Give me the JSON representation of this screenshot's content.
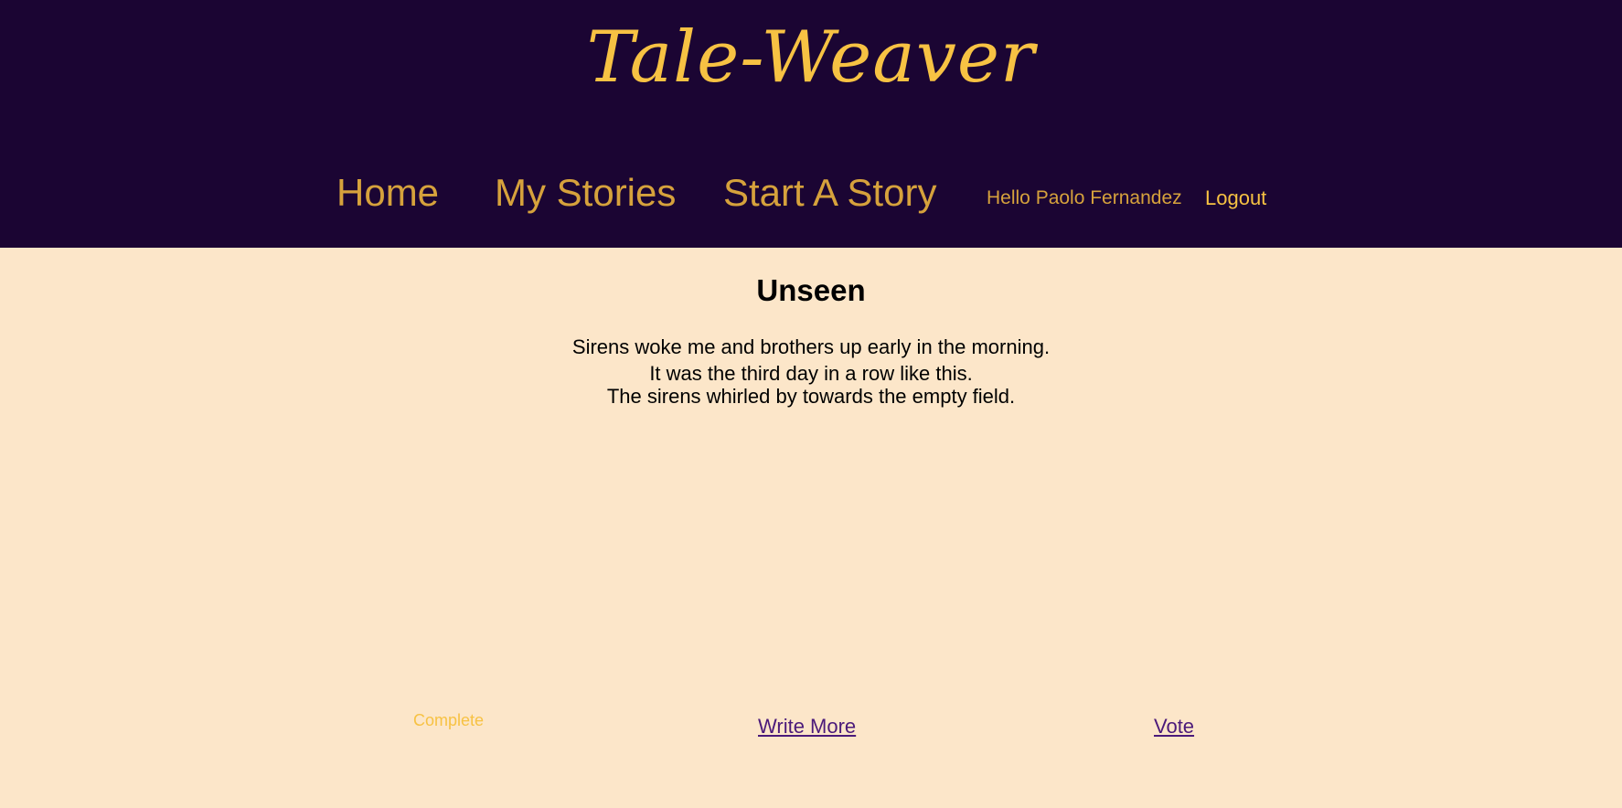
{
  "header": {
    "logo": "Tale-Weaver",
    "nav": {
      "home": "Home",
      "my_stories": "My Stories",
      "start_story": "Start A Story"
    },
    "greeting": "Hello Paolo Fernandez",
    "logout": "Logout"
  },
  "story": {
    "title": "Unseen",
    "lines": [
      "Sirens woke me and brothers up early in the morning.",
      "It was the third day in a row like this.",
      "The sirens whirled by towards the empty field."
    ],
    "status": "Complete",
    "write_more": "Write More",
    "vote": "Vote"
  },
  "colors": {
    "header_bg": "#1b0533",
    "page_bg": "#fce6c9",
    "accent_gold": "#f7c243",
    "nav_gold": "#d6a23c",
    "link_purple": "#4b1a7a"
  }
}
